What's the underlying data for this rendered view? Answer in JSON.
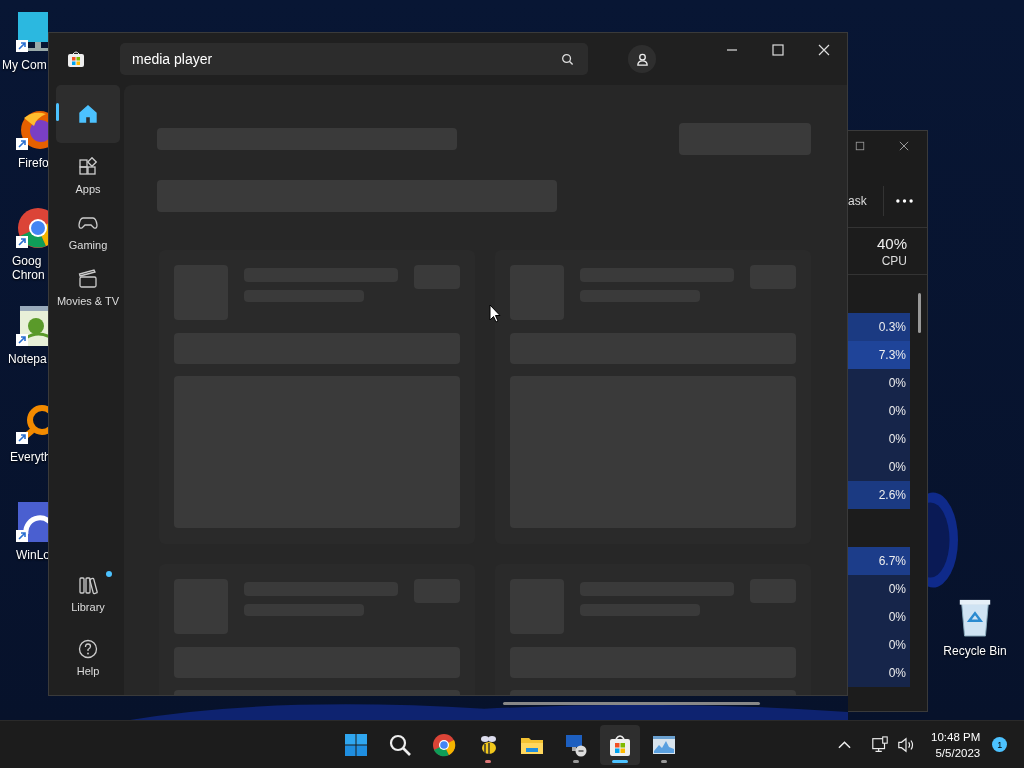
{
  "desktop_icons": [
    {
      "kind": "computer",
      "label": [
        "My Com"
      ]
    },
    {
      "kind": "firefox",
      "label": [
        "Firefo"
      ]
    },
    {
      "kind": "chrome",
      "label": [
        "Goog",
        "Chron"
      ]
    },
    {
      "kind": "notepad",
      "label": [
        "Notepa"
      ]
    },
    {
      "kind": "everything",
      "label": [
        "Everyth"
      ]
    },
    {
      "kind": "winlogbeat",
      "label": [
        "WinLo"
      ]
    }
  ],
  "recycle_bin": {
    "label": "Recycle Bin"
  },
  "background_window": {
    "toolbar_text": "ask",
    "cpu": {
      "value": "40%",
      "label": "CPU"
    },
    "rows": [
      {
        "kind": "process",
        "value": "0.3%",
        "color": "#1b3a82"
      },
      {
        "kind": "process",
        "value": "7.3%",
        "color": "#1f4499"
      },
      {
        "kind": "process",
        "value": "0%",
        "color": "#16254a"
      },
      {
        "kind": "process",
        "value": "0%",
        "color": "#16254a"
      },
      {
        "kind": "process",
        "value": "0%",
        "color": "#16254a"
      },
      {
        "kind": "process",
        "value": "0%",
        "color": "#16254a"
      },
      {
        "kind": "process",
        "value": "2.6%",
        "color": "#1b3a82"
      },
      {
        "kind": "group"
      },
      {
        "kind": "process",
        "value": "6.7%",
        "color": "#1c3d8a"
      },
      {
        "kind": "process",
        "value": "0%",
        "color": "#16254a"
      },
      {
        "kind": "process",
        "value": "0%",
        "color": "#16254a"
      },
      {
        "kind": "process",
        "value": "0%",
        "color": "#16254a"
      },
      {
        "kind": "process",
        "value": "0%",
        "color": "#16254a"
      }
    ]
  },
  "store": {
    "search": {
      "value": "media player"
    },
    "nav": [
      {
        "kind": "home",
        "selected": true
      },
      {
        "kind": "apps",
        "label": "Apps",
        "selected": false
      },
      {
        "kind": "gaming",
        "label": "Gaming",
        "selected": false
      },
      {
        "kind": "movies",
        "label": "Movies & TV",
        "selected": false
      }
    ],
    "nav_bottom": [
      {
        "kind": "library",
        "label": "Library",
        "notification": true
      },
      {
        "kind": "help",
        "label": "Help",
        "notification": false
      }
    ],
    "results": [
      {
        "kind": "placeholder"
      },
      {
        "kind": "placeholder"
      },
      {
        "kind": "placeholder"
      },
      {
        "kind": "placeholder"
      }
    ]
  },
  "taskbar": {
    "items": [
      {
        "kind": "start",
        "running": false,
        "selected": false
      },
      {
        "kind": "search",
        "running": false,
        "selected": false
      },
      {
        "kind": "chrome",
        "running": false,
        "selected": false
      },
      {
        "kind": "bee",
        "running": true,
        "selected": false,
        "color": "#dd7777"
      },
      {
        "kind": "explorer",
        "running": false,
        "selected": false
      },
      {
        "kind": "remote",
        "running": true,
        "selected": false,
        "color": "#999999"
      },
      {
        "kind": "store",
        "running": true,
        "selected": true,
        "color": "#4cc2ff"
      },
      {
        "kind": "monitor",
        "running": true,
        "selected": false,
        "color": "#999999"
      }
    ],
    "clock": {
      "time": "10:48 PM",
      "date": "5/5/2023"
    },
    "notifications": "1"
  }
}
